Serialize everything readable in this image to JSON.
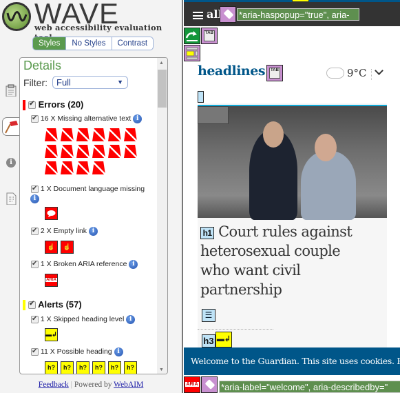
{
  "wave": {
    "logo_word": "WAVE",
    "tagline": "web accessibility evaluation tool",
    "view_tabs": [
      "Styles",
      "No Styles",
      "Contrast"
    ],
    "active_view": "Styles",
    "details": {
      "title": "Details",
      "filter_label": "Filter:",
      "filter_value": "Full",
      "categories": [
        {
          "label": "Errors (20)",
          "color": "#ff0000",
          "items": [
            {
              "label": "16 X Missing alternative text",
              "count": 16,
              "icon": "missing-alt-icon"
            },
            {
              "label": "1 X Document language missing",
              "count": 1,
              "icon": "language-missing-icon"
            },
            {
              "label": "2 X Empty link",
              "count": 2,
              "icon": "empty-link-icon"
            },
            {
              "label": "1 X Broken ARIA reference",
              "count": 1,
              "icon": "broken-aria-icon"
            }
          ]
        },
        {
          "label": "Alerts (57)",
          "color": "#ffff00",
          "items": [
            {
              "label": "1 X Skipped heading level",
              "count": 1,
              "icon": "skipped-heading-icon"
            },
            {
              "label": "11 X Possible heading",
              "count": 11,
              "icon": "possible-heading-icon",
              "icon_text": "h?"
            }
          ]
        }
      ]
    },
    "footer": {
      "feedback": "Feedback",
      "separator": "|",
      "powered_by": "Powered by",
      "webaim": "WebAIM"
    }
  },
  "page": {
    "nav_label": "all",
    "aria_top": "*aria-haspopup=\"true\", aria-",
    "headlines": "headlines",
    "tab_badge": "TAB",
    "temperature": "9°C",
    "h1_badge": "h1",
    "headline": "Court rules against heterosexual couple who want civil partnership",
    "h3_badge": "h3",
    "cookie_text": "Welcome to the Guardian. This site uses cookies. Read our policy",
    "aria_badge": "ARIA",
    "aria_bottom": "*aria-label=\"welcome\", aria-describedby=\""
  }
}
